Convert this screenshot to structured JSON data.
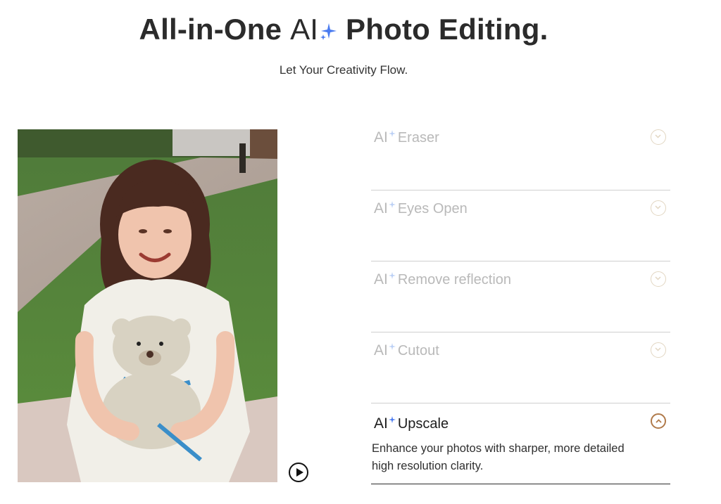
{
  "header": {
    "title_pre": "All-in-One ",
    "title_ai": "AI",
    "title_post": " Photo Editing.",
    "subtitle": "Let Your Creativity Flow."
  },
  "colors": {
    "spark": "#4a7bf0",
    "inactive_text": "#b9b9b9",
    "active_chevron": "#b07a4a"
  },
  "features": [
    {
      "ai": "AI",
      "label": "Eraser",
      "active": false
    },
    {
      "ai": "AI",
      "label": "Eyes Open",
      "active": false
    },
    {
      "ai": "AI",
      "label": "Remove reflection",
      "active": false
    },
    {
      "ai": "AI",
      "label": "Cutout",
      "active": false
    },
    {
      "ai": "AI",
      "label": "Upscale",
      "active": true,
      "description": "Enhance your photos with sharper, more detailed high resolution clarity."
    }
  ],
  "icons": {
    "play": "play-circle-icon",
    "sparkle": "sparkle-icon",
    "chevron_down": "chevron-down-icon",
    "chevron_up": "chevron-up-icon"
  }
}
